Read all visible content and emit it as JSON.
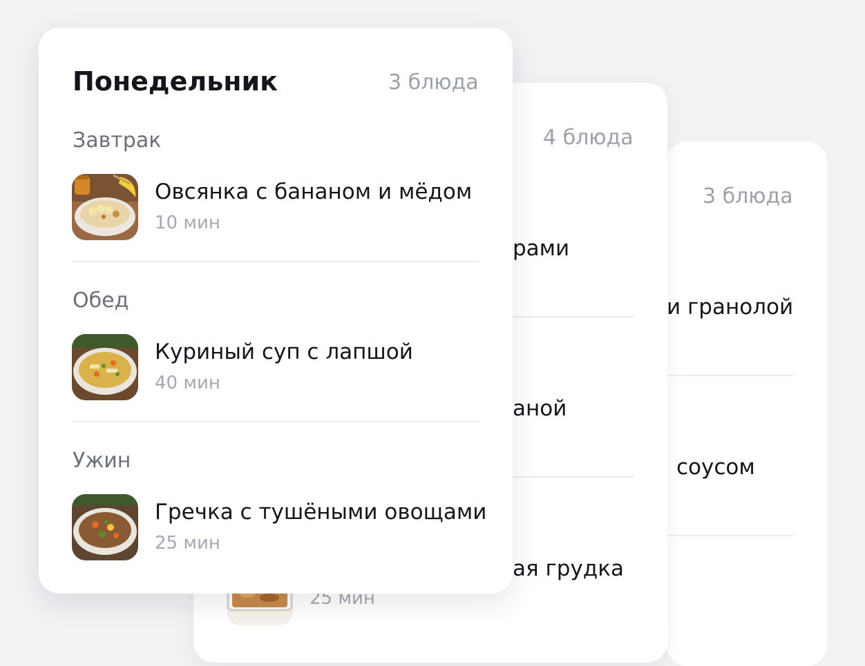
{
  "cards": {
    "back": {
      "count": "3 блюда",
      "fragments": [
        "и гранолой",
        "соусом"
      ]
    },
    "middle": {
      "count": "4 блюда",
      "fragments": [
        "рами",
        "аной",
        "ая грудка"
      ],
      "time": "25 мин"
    },
    "front": {
      "day": "Понедельник",
      "count": "3 блюда",
      "meals": [
        {
          "label": "Завтрак",
          "dish": "Овсянка с бананом и мёдом",
          "time": "10 мин",
          "image": "oatmeal-banana-honey"
        },
        {
          "label": "Обед",
          "dish": "Куриный суп с лапшой",
          "time": "40 мин",
          "image": "chicken-noodle-soup"
        },
        {
          "label": "Ужин",
          "dish": "Гречка с тушёными овощами",
          "time": "25 мин",
          "image": "buckwheat-stewed-vegetables"
        }
      ]
    }
  }
}
